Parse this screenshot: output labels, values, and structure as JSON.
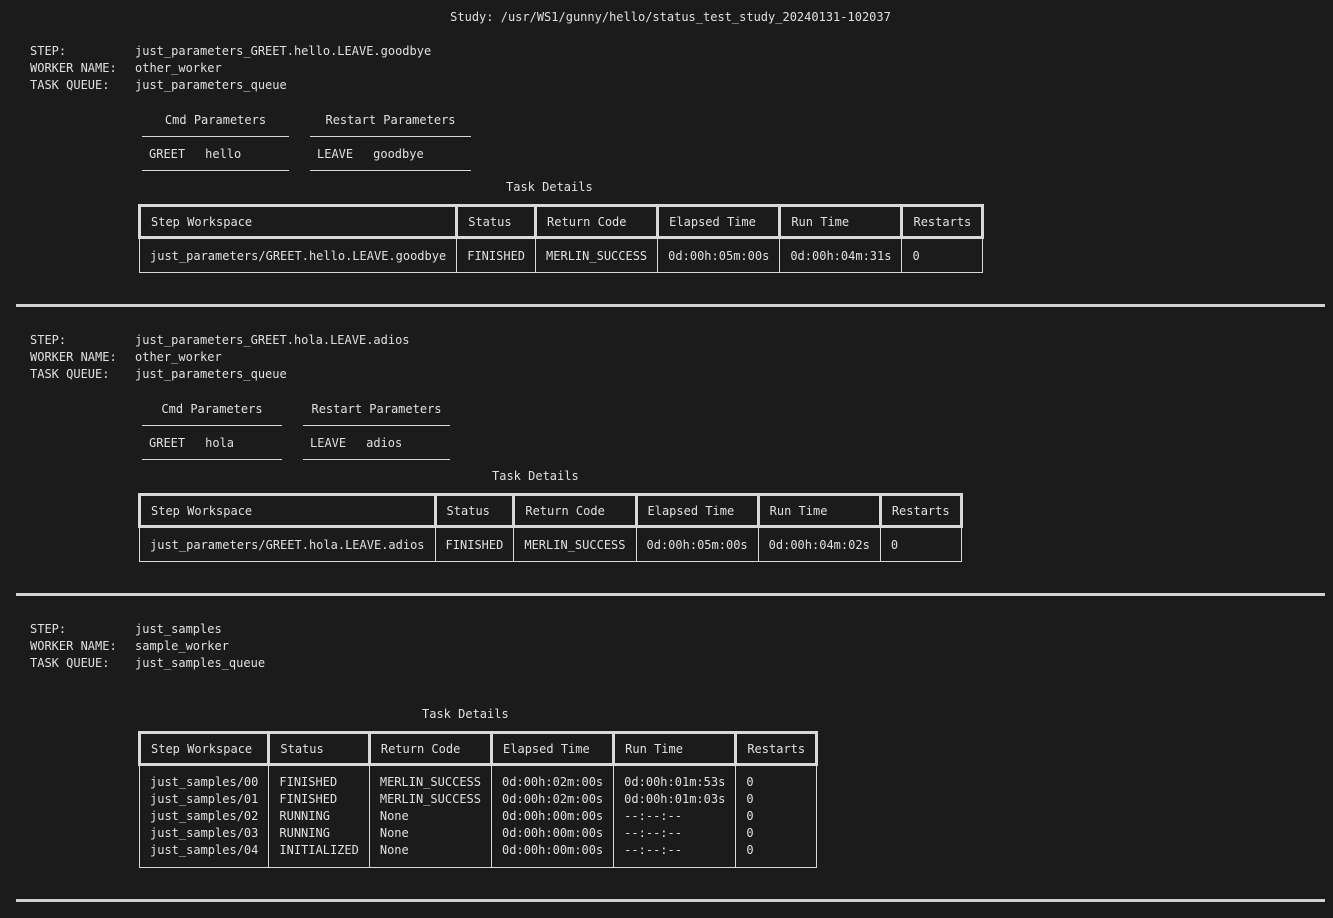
{
  "study_title": "Study: /usr/WS1/gunny/hello/status_test_study_20240131-102037",
  "labels": {
    "step": "STEP:",
    "worker": "WORKER NAME:",
    "queue": "TASK QUEUE:",
    "cmd_params": "Cmd Parameters",
    "restart_params": "Restart Parameters",
    "task_details": "Task Details"
  },
  "columns": [
    "Step Workspace",
    "Status",
    "Return Code",
    "Elapsed Time",
    "Run Time",
    "Restarts"
  ],
  "steps": [
    {
      "step": "just_parameters_GREET.hello.LEAVE.goodbye",
      "worker": "other_worker",
      "queue": "just_parameters_queue",
      "cmd_param": {
        "name": "GREET",
        "value": "hello"
      },
      "restart_param": {
        "name": "LEAVE",
        "value": "goodbye"
      },
      "row": {
        "workspace": "just_parameters/GREET.hello.LEAVE.goodbye",
        "status": "FINISHED",
        "return_code": "MERLIN_SUCCESS",
        "elapsed": "0d:00h:05m:00s",
        "run_time": "0d:00h:04m:31s",
        "restarts": "0"
      }
    },
    {
      "step": "just_parameters_GREET.hola.LEAVE.adios",
      "worker": "other_worker",
      "queue": "just_parameters_queue",
      "cmd_param": {
        "name": "GREET",
        "value": "hola"
      },
      "restart_param": {
        "name": "LEAVE",
        "value": "adios"
      },
      "row": {
        "workspace": "just_parameters/GREET.hola.LEAVE.adios",
        "status": "FINISHED",
        "return_code": "MERLIN_SUCCESS",
        "elapsed": "0d:00h:05m:00s",
        "run_time": "0d:00h:04m:02s",
        "restarts": "0"
      }
    },
    {
      "step": "just_samples",
      "worker": "sample_worker",
      "queue": "just_samples_queue",
      "samples": {
        "workspace": "just_samples/00\njust_samples/01\njust_samples/02\njust_samples/03\njust_samples/04",
        "status": "FINISHED\nFINISHED\nRUNNING\nRUNNING\nINITIALIZED",
        "return_code": "MERLIN_SUCCESS\nMERLIN_SUCCESS\nNone\nNone\nNone",
        "elapsed": "0d:00h:02m:00s\n0d:00h:02m:00s\n0d:00h:00m:00s\n0d:00h:00m:00s\n0d:00h:00m:00s",
        "run_time": "0d:00h:01m:53s\n0d:00h:01m:03s\n--:--:--\n--:--:--\n--:--:--",
        "restarts": "0\n0\n0\n0\n0"
      }
    }
  ]
}
